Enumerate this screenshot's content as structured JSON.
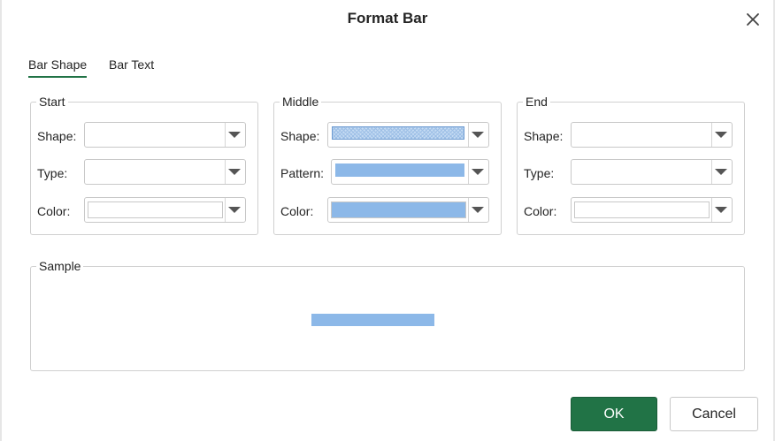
{
  "dialog": {
    "title": "Format Bar"
  },
  "tabs": [
    {
      "label": "Bar Shape",
      "active": true
    },
    {
      "label": "Bar Text",
      "active": false
    }
  ],
  "groups": {
    "start": {
      "legend": "Start",
      "shape_label": "Shape:",
      "type_label": "Type:",
      "color_label": "Color:",
      "color_value": "#ffffff"
    },
    "middle": {
      "legend": "Middle",
      "shape_label": "Shape:",
      "pattern_label": "Pattern:",
      "color_label": "Color:",
      "color_value": "#8cb8e8"
    },
    "end": {
      "legend": "End",
      "shape_label": "Shape:",
      "type_label": "Type:",
      "color_label": "Color:",
      "color_value": "#ffffff"
    }
  },
  "sample": {
    "legend": "Sample",
    "bar_color": "#8cb8e8"
  },
  "buttons": {
    "ok": "OK",
    "cancel": "Cancel"
  },
  "colors": {
    "accent": "#217346",
    "bar_fill": "#8cb8e8",
    "border": "#d0d0d0"
  },
  "icons": {
    "close": "close-icon",
    "dropdown": "chevron-down-icon"
  }
}
